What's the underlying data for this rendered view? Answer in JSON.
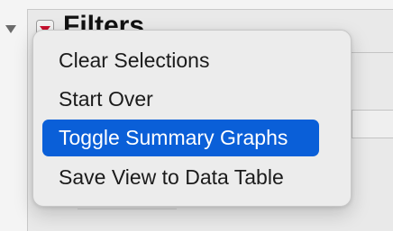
{
  "filters_panel": {
    "title": "Filters"
  },
  "context_menu": {
    "items": [
      {
        "label": "Clear Selections",
        "highlighted": false
      },
      {
        "label": "Start Over",
        "highlighted": false
      },
      {
        "label": "Toggle Summary Graphs",
        "highlighted": true
      },
      {
        "label": "Save View to Data Table",
        "highlighted": false
      }
    ]
  },
  "colors": {
    "highlight": "#0a5fd8",
    "toggle_red": "#c8102e"
  },
  "icons": {
    "disclosure": "disclosure-triangle-down-icon",
    "red_triangle": "red-triangle-menu-icon"
  }
}
